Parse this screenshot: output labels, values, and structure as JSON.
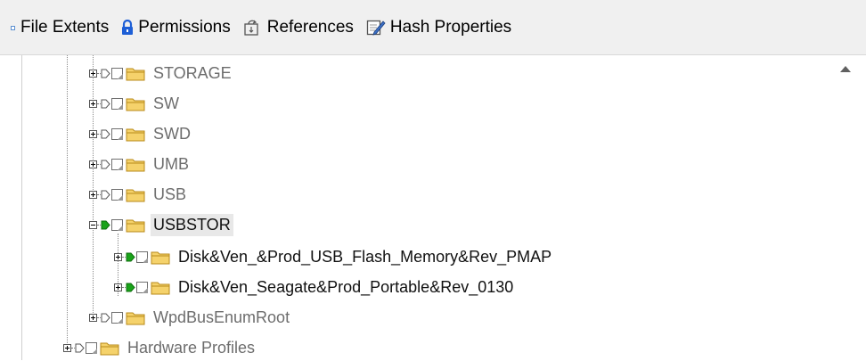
{
  "toolbar": {
    "items": [
      {
        "label": "File Extents",
        "icon": "small-square-icon"
      },
      {
        "label": "Permissions",
        "icon": "lock-icon"
      },
      {
        "label": "References",
        "icon": "references-icon"
      },
      {
        "label": "Hash Properties",
        "icon": "hash-properties-icon"
      }
    ]
  },
  "tree": {
    "nodes": [
      {
        "label": "STORAGE",
        "marker": "hollow",
        "expanded": false,
        "selected": false
      },
      {
        "label": "SW",
        "marker": "hollow",
        "expanded": false,
        "selected": false
      },
      {
        "label": "SWD",
        "marker": "hollow",
        "expanded": false,
        "selected": false
      },
      {
        "label": "UMB",
        "marker": "hollow",
        "expanded": false,
        "selected": false
      },
      {
        "label": "USB",
        "marker": "hollow",
        "expanded": false,
        "selected": false
      },
      {
        "label": "USBSTOR",
        "marker": "green",
        "expanded": true,
        "selected": true
      },
      {
        "label": "Disk&Ven_&Prod_USB_Flash_Memory&Rev_PMAP",
        "marker": "green",
        "expanded": false,
        "selected": false
      },
      {
        "label": "Disk&Ven_Seagate&Prod_Portable&Rev_0130",
        "marker": "green",
        "expanded": false,
        "selected": false
      },
      {
        "label": "WpdBusEnumRoot",
        "marker": "hollow",
        "expanded": false,
        "selected": false
      },
      {
        "label": "Hardware Profiles",
        "marker": "hollow",
        "expanded": false,
        "selected": false
      }
    ]
  },
  "colors": {
    "marker_green": "#1aa31a",
    "folder_fill": "#f5d26b",
    "folder_stroke": "#b88a1a",
    "lock_blue": "#1e5fd6"
  }
}
